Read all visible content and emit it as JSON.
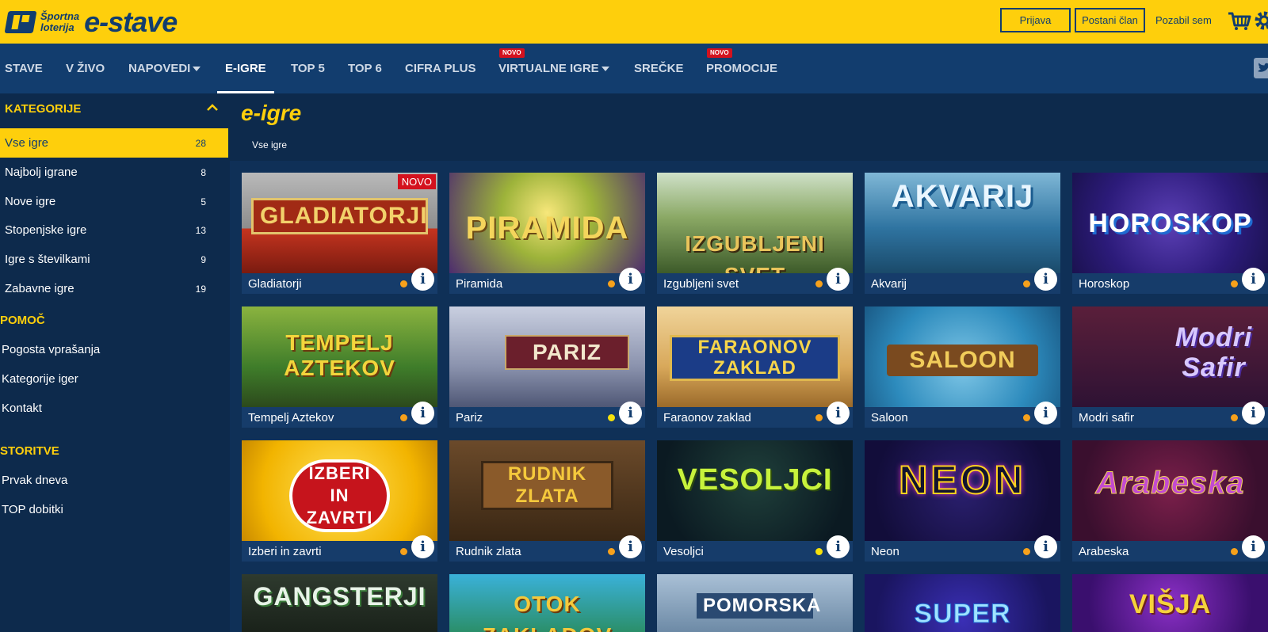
{
  "header": {
    "logo_small_line1": "Športna",
    "logo_small_line2": "loterija",
    "logo_big": "e-stave",
    "login": "Prijava",
    "register": "Postani član",
    "forgot": "Pozabil sem"
  },
  "nav": {
    "items": [
      "STAVE",
      "V ŽIVO",
      "NAPOVEDI",
      "E-IGRE",
      "TOP 5",
      "TOP 6",
      "CIFRA PLUS",
      "VIRTUALNE IGRE",
      "SREČKE",
      "PROMOCIJE"
    ],
    "badge": "NOVO"
  },
  "sidebar": {
    "categories_title": "KATEGORIJE",
    "categories": [
      {
        "label": "Vse igre",
        "count": "28"
      },
      {
        "label": "Najbolj igrane",
        "count": "8"
      },
      {
        "label": "Nove igre",
        "count": "5"
      },
      {
        "label": "Stopenjske igre",
        "count": "13"
      },
      {
        "label": "Igre s številkami",
        "count": "9"
      },
      {
        "label": "Zabavne igre",
        "count": "19"
      }
    ],
    "help_title": "POMOČ",
    "help_links": [
      "Pogosta vprašanja",
      "Kategorije iger",
      "Kontakt"
    ],
    "services_title": "STORITVE",
    "services_links": [
      "Prvak dneva",
      "TOP dobitki"
    ]
  },
  "main": {
    "title": "e-igre",
    "breadcrumb": "Vse igre",
    "new_badge": "NOVO",
    "info_glyph": "i",
    "games": [
      {
        "name": "Gladiatorji",
        "thumb": "GLADIATORJI"
      },
      {
        "name": "Piramida",
        "thumb": "PIRAMIDA"
      },
      {
        "name": "Izgubljeni svet",
        "thumb": "IZGUBLJENI SVET"
      },
      {
        "name": "Akvarij",
        "thumb": "AKVARIJ"
      },
      {
        "name": "Horoskop",
        "thumb": "HOROSKOP"
      },
      {
        "name": "Tempelj Aztekov",
        "thumb": "TEMPELJ AZTEKOV"
      },
      {
        "name": "Pariz",
        "thumb": "PARIZ"
      },
      {
        "name": "Faraonov zaklad",
        "thumb": "FARAONOV ZAKLAD"
      },
      {
        "name": "Saloon",
        "thumb": "SALOON"
      },
      {
        "name": "Modri safir",
        "thumb": "Modri Safir"
      },
      {
        "name": "Izberi in zavrti",
        "thumb": "IZBERI IN ZAVRTI"
      },
      {
        "name": "Rudnik zlata",
        "thumb": "RUDNIK ZLATA"
      },
      {
        "name": "Vesoljci",
        "thumb": "VESOLJCI"
      },
      {
        "name": "Neon",
        "thumb": "NEON"
      },
      {
        "name": "Arabeska",
        "thumb": "Arabeska"
      },
      {
        "name": "",
        "thumb": "GANGSTERJI"
      },
      {
        "name": "",
        "thumb": "OTOK ZAKLADOV"
      },
      {
        "name": "",
        "thumb": "POMORSKA"
      },
      {
        "name": "",
        "thumb": "SUPER"
      },
      {
        "name": "",
        "thumb": "VIŠJA"
      }
    ]
  },
  "colors": {
    "brand_yellow": "#fecf0c",
    "nav_blue": "#123d6e",
    "page_blue": "#0d2a4c",
    "badge_red": "#d4121e",
    "dot_orange": "#f7a11b",
    "dot_yellow": "#f5e10c"
  },
  "icons": [
    "cart-icon",
    "gear-icon",
    "twitter-icon",
    "chevron-up-icon",
    "info-icon",
    "caret-down-icon"
  ]
}
